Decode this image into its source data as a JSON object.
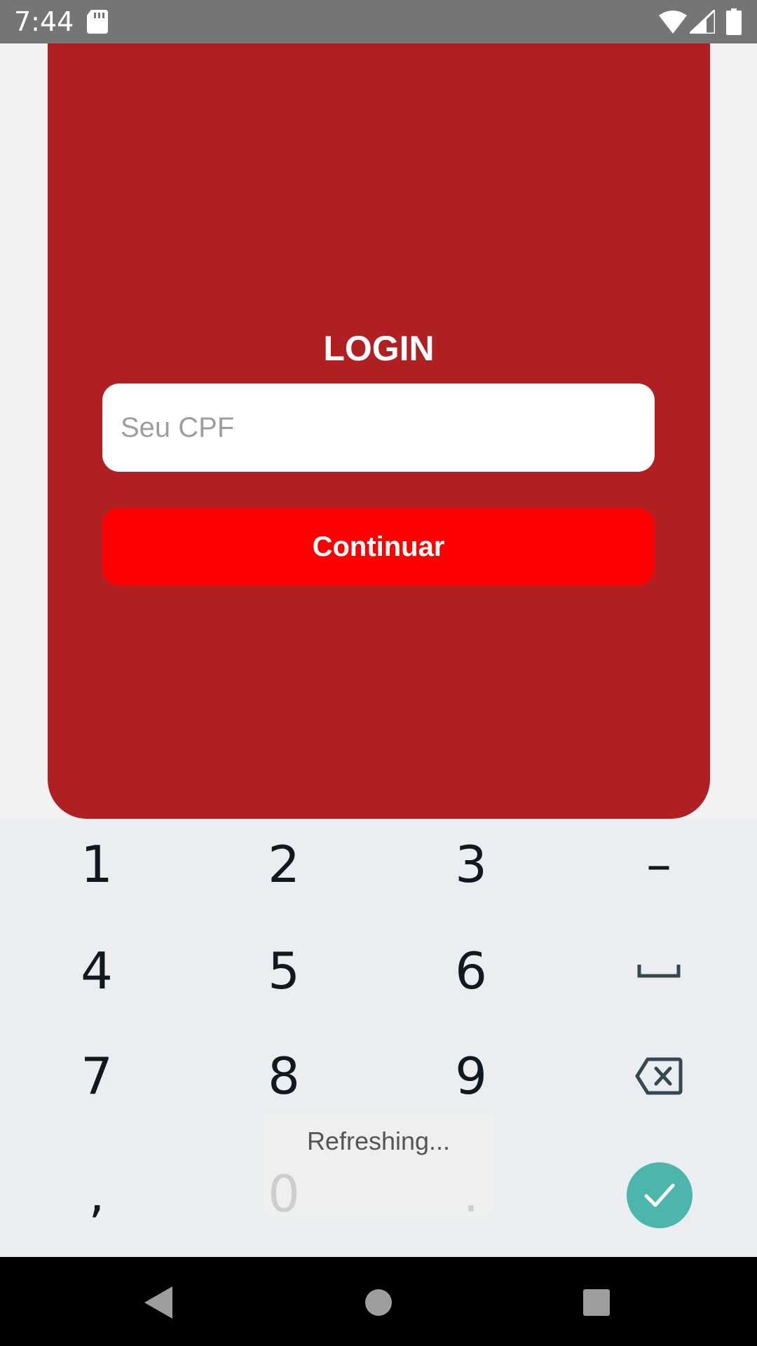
{
  "status_bar": {
    "time": "7:44"
  },
  "login": {
    "title": "LOGIN",
    "cpf_placeholder": "Seu CPF",
    "cpf_value": "",
    "continue_label": "Continuar"
  },
  "keyboard": {
    "keys": [
      "1",
      "2",
      "3",
      "–",
      "4",
      "5",
      "6",
      "7",
      "8",
      "9",
      ",",
      "0",
      "."
    ],
    "space_icon": "space-bar-icon",
    "backspace_icon": "backspace-icon",
    "done_icon": "check-icon"
  },
  "toast": {
    "text": "Refreshing..."
  },
  "colors": {
    "card": "#b01f21",
    "button": "#ff0000",
    "done": "#4db6ac",
    "status_bar": "#757575"
  }
}
